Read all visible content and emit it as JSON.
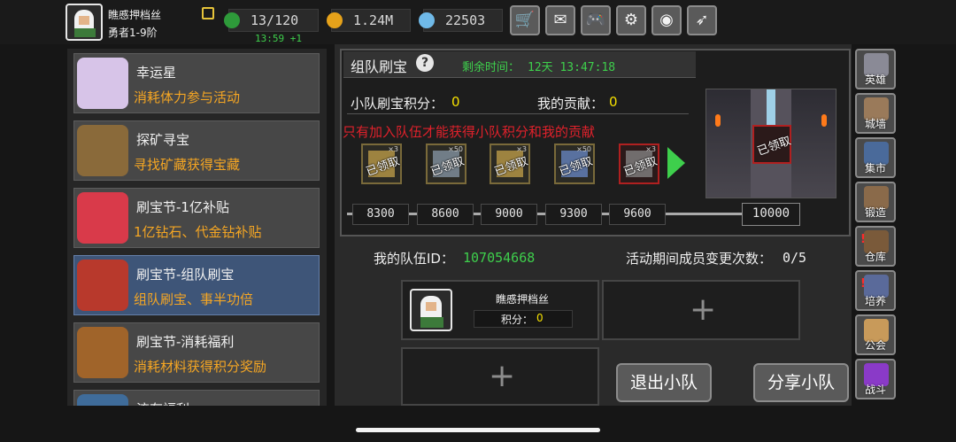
{
  "player": {
    "name": "瞧慼押档丝",
    "rank": "勇者1-9阶"
  },
  "stats": {
    "stamina": "13/120",
    "stamina_timer": "13:59 +1",
    "gold": "1.24M",
    "gems": "22503"
  },
  "top_buttons": [
    {
      "icon": "cart-icon",
      "glyph": "🛒"
    },
    {
      "icon": "mail-icon",
      "glyph": "✉"
    },
    {
      "icon": "gamepad-icon",
      "glyph": "🎮"
    },
    {
      "icon": "gear-icon",
      "glyph": "⚙"
    },
    {
      "icon": "color-wheel-icon",
      "glyph": "◉"
    },
    {
      "icon": "feather-icon",
      "glyph": "➶"
    }
  ],
  "events": [
    {
      "title": "幸运星",
      "desc": "消耗体力参与活动",
      "icon": "star-crystal-icon",
      "color": "#d7c4e8"
    },
    {
      "title": "探矿寻宝",
      "desc": "寻找矿藏获得宝藏",
      "icon": "treasure-cart-icon",
      "color": "#8a6a3a"
    },
    {
      "title": "刷宝节-1亿补贴",
      "desc": "1亿钻石、代金钻补贴",
      "icon": "red-flower-icon",
      "color": "#d93a4a"
    },
    {
      "title": "刷宝节-组队刷宝",
      "desc": "组队刷宝、事半功倍",
      "icon": "red-chest-icon",
      "color": "#b8392c"
    },
    {
      "title": "刷宝节-消耗福利",
      "desc": "消耗材料获得积分奖励",
      "icon": "open-chest-icon",
      "color": "#a0642a"
    },
    {
      "title": "流存福利",
      "desc": "",
      "icon": "partial-event-icon",
      "color": "#3f6c9a"
    }
  ],
  "panel": {
    "title": "组队刷宝",
    "time_label": "剩余时间：",
    "time_value": "12天 13:47:18",
    "squad_points_label": "小队刷宝积分：",
    "squad_points": "0",
    "contribution_label": "我的贡献：",
    "contribution": "0",
    "warning": "只有加入队伍才能获得小队积分和我的贡献",
    "claimed_label": "已领取",
    "reward_counts": [
      "×3",
      "×50",
      "×3",
      "×50",
      "×3"
    ],
    "milestones": [
      "8300",
      "8600",
      "9000",
      "9300",
      "9600"
    ],
    "final_milestone": "10000",
    "final_claimed": "已领取"
  },
  "team": {
    "id_label": "我的队伍ID：",
    "id_value": "107054668",
    "change_label": "活动期间成员变更次数：",
    "change_value": "0/5",
    "member_name": "瞧慼押档丝",
    "member_score_label": "积分：",
    "member_score": "0",
    "leave_button": "退出小队",
    "share_button": "分享小队"
  },
  "sidebar": [
    {
      "label": "英雄",
      "icon": "helmet-icon",
      "color": "#8a8a96",
      "alert": false
    },
    {
      "label": "城墙",
      "icon": "wall-icon",
      "color": "#9a7a5a",
      "alert": false
    },
    {
      "label": "集市",
      "icon": "market-icon",
      "color": "#4a6a9a",
      "alert": false
    },
    {
      "label": "锻造",
      "icon": "anvil-icon",
      "color": "#8a6a4a",
      "alert": false
    },
    {
      "label": "仓库",
      "icon": "warehouse-icon",
      "color": "#7a5a3a",
      "alert": true
    },
    {
      "label": "培养",
      "icon": "training-icon",
      "color": "#5a6a9a",
      "alert": true
    },
    {
      "label": "公会",
      "icon": "guild-icon",
      "color": "#c89a5a",
      "alert": false
    },
    {
      "label": "战斗",
      "icon": "portal-icon",
      "color": "#8a3ac8",
      "alert": false
    }
  ],
  "alert_glyph": "!"
}
